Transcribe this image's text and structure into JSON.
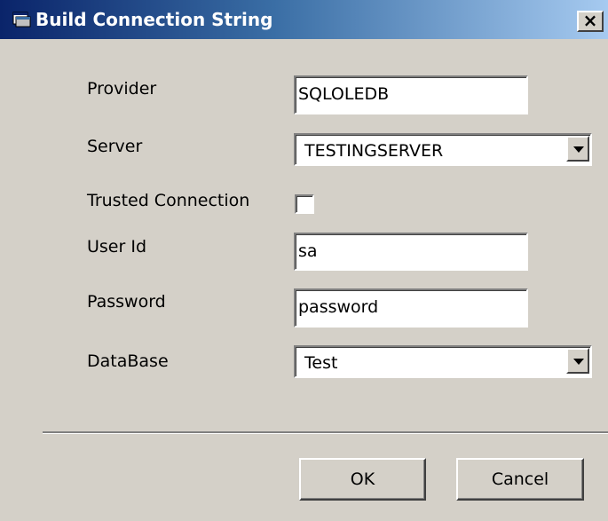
{
  "window": {
    "title": "Build Connection String",
    "close_glyph": "×",
    "title_bar_color": "#0a246a"
  },
  "form": {
    "provider": {
      "label": "Provider",
      "value": "SQLOLEDB"
    },
    "server": {
      "label": "Server",
      "value": "TESTINGSERVER"
    },
    "trusted_connection": {
      "label": "Trusted Connection",
      "checked": false
    },
    "user_id": {
      "label": "User Id",
      "value": "sa"
    },
    "password": {
      "label": "Password",
      "value": "password"
    },
    "database": {
      "label": "DataBase",
      "value": "Test"
    }
  },
  "buttons": {
    "ok_label": "OK",
    "cancel_label": "Cancel"
  },
  "icons": {
    "app": "window-app-icon",
    "close": "close-icon",
    "dropdown": "chevron-down-icon"
  }
}
